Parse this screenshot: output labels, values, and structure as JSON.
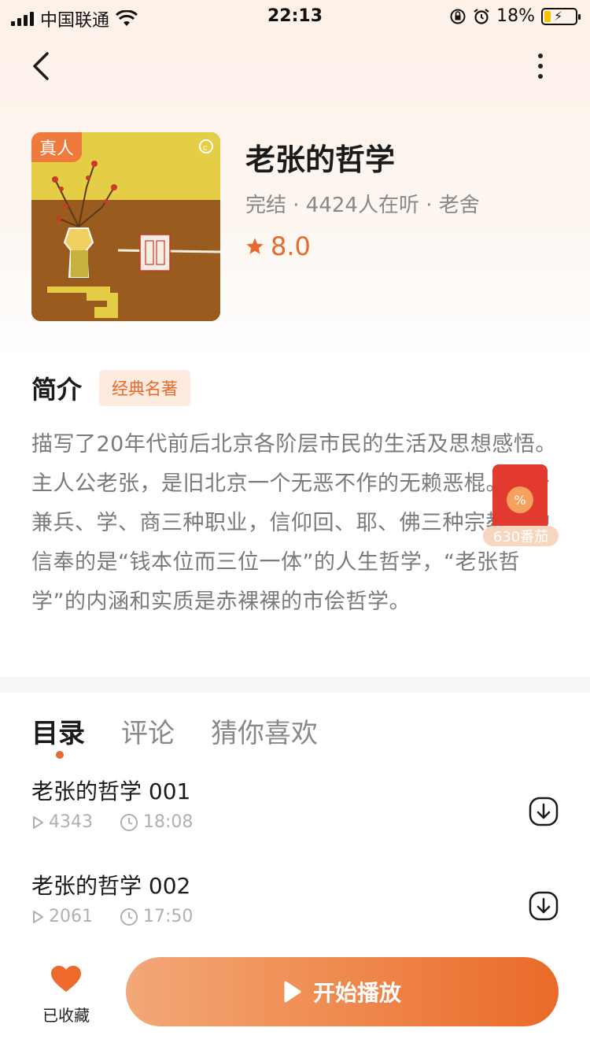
{
  "status_bar": {
    "carrier": "中国联通",
    "time": "22:13",
    "battery": "18%"
  },
  "book": {
    "badge": "真人",
    "title": "老张的哲学",
    "meta": "完结 · 4424人在听 · 老舍",
    "rating": "8.0"
  },
  "intro": {
    "title": "简介",
    "tag": "经典名著",
    "text": "描写了20年代前后北京各阶层市民的生活及思想感悟。主人公老张，是旧北京一个无恶不作的无赖恶棍。他身兼兵、学、商三种职业，信仰回、耶、佛三种宗教；他信奉的是“钱本位而三位一体”的人生哲学，“老张哲学”的内涵和实质是赤裸裸的市侩哲学。"
  },
  "red_packet": {
    "label": "630番茄"
  },
  "tabs": [
    "目录",
    "评论",
    "猜你喜欢"
  ],
  "episodes": [
    {
      "title": "老张的哲学 001",
      "plays": "4343",
      "duration": "18:08"
    },
    {
      "title": "老张的哲学 002",
      "plays": "2061",
      "duration": "17:50"
    }
  ],
  "bottom": {
    "fav_label": "已收藏",
    "play_label": "开始播放"
  },
  "colors": {
    "accent": "#e8692d",
    "red_packet": "#e23a2e"
  }
}
